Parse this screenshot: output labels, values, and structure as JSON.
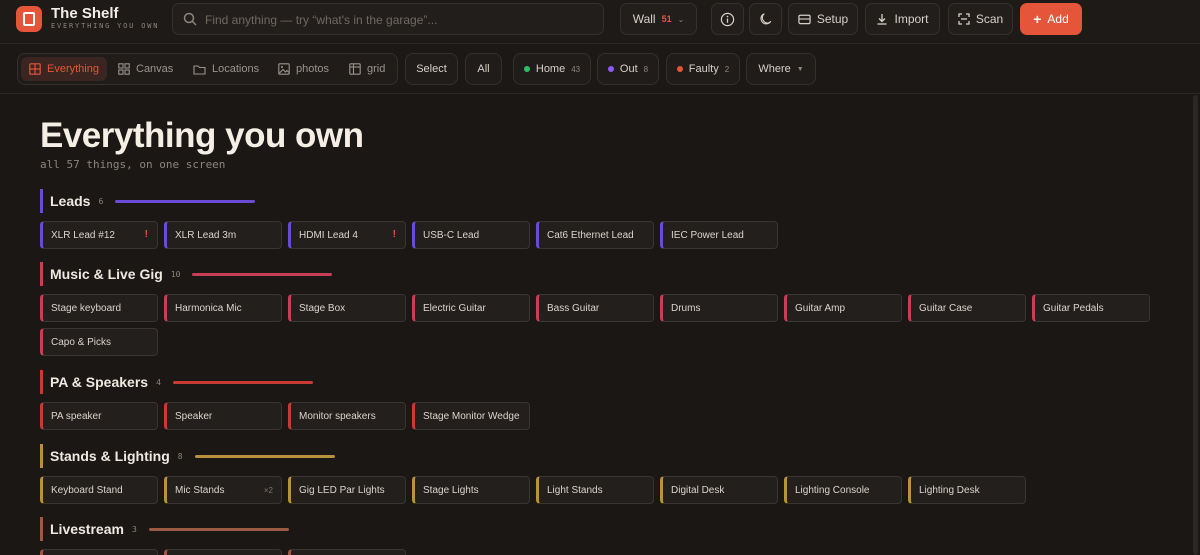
{
  "app": {
    "title": "The Shelf",
    "subtitle": "EVERYTHING YOU OWN"
  },
  "search": {
    "placeholder": "Find anything — try “what's in the garage”..."
  },
  "toolbar": {
    "wall_label": "Wall",
    "wall_count": "51",
    "setup_label": "Setup",
    "import_label": "Import",
    "scan_label": "Scan",
    "add_label": "Add"
  },
  "views": [
    {
      "label": "Everything",
      "icon": "grid-icon",
      "active": true
    },
    {
      "label": "Canvas",
      "icon": "grid-icon"
    },
    {
      "label": "Locations",
      "icon": "folder-icon"
    },
    {
      "label": "photos",
      "icon": "image-icon"
    },
    {
      "label": "grid",
      "icon": "table-icon"
    }
  ],
  "filters": {
    "select_label": "Select",
    "all_label": "All",
    "home": {
      "label": "Home",
      "count": "43",
      "color": "#2ebd6b"
    },
    "out": {
      "label": "Out",
      "count": "8",
      "color": "#8a5cf5"
    },
    "faulty": {
      "label": "Faulty",
      "count": "2",
      "color": "#e5553a"
    },
    "where_label": "Where"
  },
  "page": {
    "title": "Everything you own",
    "subtitle": "all 57 things, on one screen"
  },
  "sections": [
    {
      "name": "Leads",
      "count": "6",
      "color": "#6a4bd6",
      "items": [
        {
          "name": "XLR Lead #12",
          "flag": "!"
        },
        {
          "name": "XLR Lead 3m"
        },
        {
          "name": "HDMI Lead 4",
          "flag": "!"
        },
        {
          "name": "USB-C Lead"
        },
        {
          "name": "Cat6 Ethernet Lead"
        },
        {
          "name": "IEC Power Lead"
        }
      ]
    },
    {
      "name": "Music & Live Gig",
      "count": "10",
      "color": "#c83e57",
      "items": [
        {
          "name": "Stage keyboard"
        },
        {
          "name": "Harmonica Mic"
        },
        {
          "name": "Stage Box"
        },
        {
          "name": "Electric Guitar"
        },
        {
          "name": "Bass Guitar"
        },
        {
          "name": "Drums"
        },
        {
          "name": "Guitar Amp"
        },
        {
          "name": "Guitar Case"
        },
        {
          "name": "Guitar Pedals"
        },
        {
          "name": "Capo & Picks"
        }
      ]
    },
    {
      "name": "PA & Speakers",
      "count": "4",
      "color": "#c93a32",
      "items": [
        {
          "name": "PA speaker"
        },
        {
          "name": "Speaker"
        },
        {
          "name": "Monitor speakers"
        },
        {
          "name": "Stage Monitor Wedge"
        }
      ]
    },
    {
      "name": "Stands & Lighting",
      "count": "8",
      "color": "#b8913a",
      "items": [
        {
          "name": "Keyboard Stand"
        },
        {
          "name": "Mic Stands",
          "qty": "×2"
        },
        {
          "name": "Gig LED Par Lights"
        },
        {
          "name": "Stage Lights"
        },
        {
          "name": "Light Stands"
        },
        {
          "name": "Digital Desk"
        },
        {
          "name": "Lighting Console"
        },
        {
          "name": "Lighting Desk"
        }
      ]
    },
    {
      "name": "Livestream",
      "count": "3",
      "color": "#9c5a44",
      "items": [
        {
          "name": ""
        },
        {
          "name": ""
        },
        {
          "name": ""
        }
      ]
    }
  ]
}
